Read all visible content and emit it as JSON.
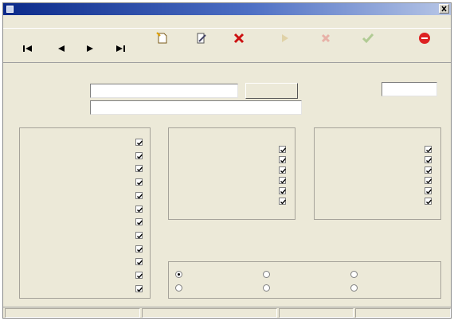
{
  "window": {
    "title": ""
  },
  "menu": [
    {
      "label": ""
    },
    {
      "label": ""
    },
    {
      "label": ""
    },
    {
      "label": ""
    }
  ],
  "toolbar": {
    "nav": [
      {
        "icon": "first-record-icon"
      },
      {
        "icon": "prev-record-icon"
      },
      {
        "icon": "next-record-icon"
      },
      {
        "icon": "last-record-icon"
      }
    ],
    "buttons": [
      {
        "label": "",
        "icon": "new-document-icon",
        "enabled": true
      },
      {
        "label": "",
        "icon": "edit-icon",
        "enabled": true
      },
      {
        "label": "",
        "icon": "delete-icon",
        "enabled": true
      },
      {
        "label": "",
        "icon": "refresh-icon",
        "enabled": false
      },
      {
        "label": "",
        "icon": "cancel-icon",
        "enabled": false
      },
      {
        "label": "",
        "icon": "save-icon",
        "enabled": false
      },
      {
        "label": "",
        "icon": "close-icon",
        "enabled": true
      }
    ]
  },
  "form": {
    "operator_name_label": "",
    "operator_name_value": "",
    "browse_button": "",
    "operator_id_label": "",
    "operator_id_value": "",
    "description_label": "",
    "description_value": ""
  },
  "groups": {
    "general": {
      "legend": "",
      "items": [
        {
          "label": "",
          "checked": true
        },
        {
          "label": "",
          "checked": true
        },
        {
          "label": "",
          "checked": true
        },
        {
          "label": "",
          "checked": true
        },
        {
          "label": "",
          "checked": true
        },
        {
          "label": "",
          "checked": true
        },
        {
          "label": "",
          "checked": true
        },
        {
          "label": "",
          "checked": true
        },
        {
          "label": "",
          "checked": true
        },
        {
          "label": "",
          "checked": true
        },
        {
          "label": "",
          "checked": true
        },
        {
          "label": "",
          "checked": true
        }
      ]
    },
    "view": {
      "legend": "",
      "items": [
        {
          "label": "",
          "checked": true
        },
        {
          "label": "",
          "checked": true
        },
        {
          "label": "",
          "checked": true
        },
        {
          "label": "",
          "checked": true
        },
        {
          "label": "",
          "checked": true
        },
        {
          "label": "",
          "checked": true
        }
      ]
    },
    "edit": {
      "legend": "",
      "items": [
        {
          "label": "",
          "checked": true
        },
        {
          "label": "",
          "checked": true
        },
        {
          "label": "",
          "checked": true
        },
        {
          "label": "",
          "checked": true
        },
        {
          "label": "",
          "checked": true
        },
        {
          "label": "",
          "checked": true
        }
      ]
    },
    "operator_type": {
      "legend": "",
      "selected": 0,
      "options": [
        {
          "label": ""
        },
        {
          "label": ""
        },
        {
          "label": ""
        },
        {
          "label": ""
        },
        {
          "label": ""
        },
        {
          "label": ""
        }
      ]
    }
  },
  "status": {
    "mode": "",
    "operator": "",
    "record": "",
    "time": ""
  }
}
